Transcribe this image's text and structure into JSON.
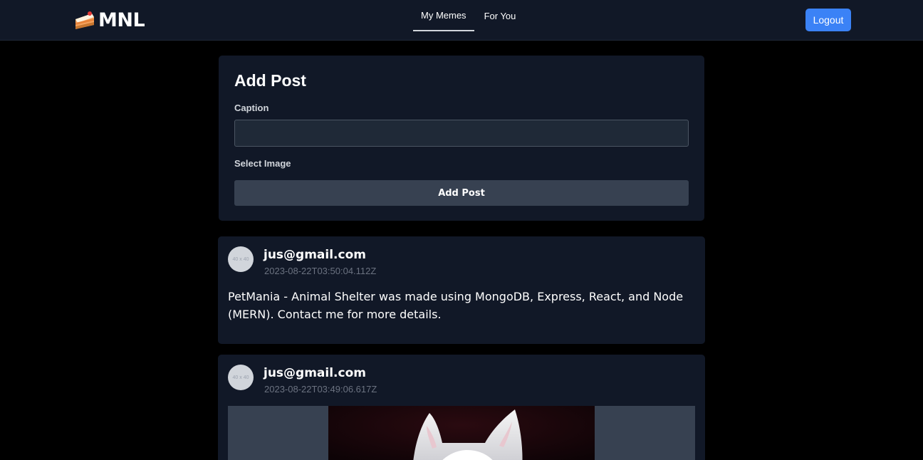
{
  "app": {
    "brand": "MNL",
    "brand_icon": "cake-icon"
  },
  "nav": {
    "tabs": [
      {
        "label": "My Memes",
        "active": true
      },
      {
        "label": "For You",
        "active": false
      }
    ],
    "logout_label": "Logout"
  },
  "add_post": {
    "title": "Add Post",
    "caption_label": "Caption",
    "caption_value": "",
    "select_image_label": "Select Image",
    "button_label": "Add Post"
  },
  "posts": [
    {
      "avatar_text": "40 x 40",
      "author": "jus@gmail.com",
      "timestamp": "2023-08-22T03:50:04.112Z",
      "text": "PetMania - Animal Shelter was made using MongoDB, Express, React, and Node (MERN). Contact me for more details."
    },
    {
      "avatar_text": "40 x 40",
      "author": "jus@gmail.com",
      "timestamp": "2023-08-22T03:49:06.617Z",
      "image": "cat-photo"
    }
  ],
  "colors": {
    "background": "#000000",
    "navbar": "#111827",
    "card": "#111827",
    "accent": "#3b82f6",
    "input": "#1f2937",
    "button": "#374151"
  }
}
